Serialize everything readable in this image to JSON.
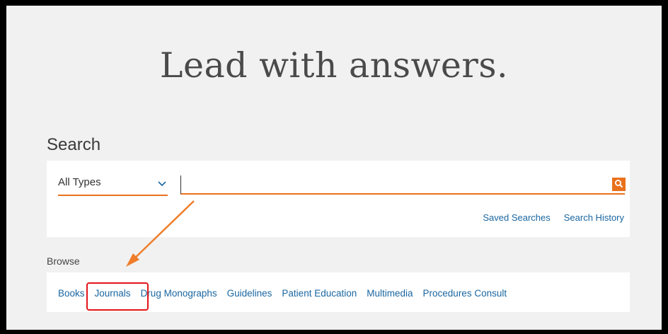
{
  "hero": {
    "title": "Lead with answers."
  },
  "search": {
    "label": "Search",
    "type_select": {
      "value": "All Types",
      "icon": "chevron-down-icon"
    },
    "input": {
      "value": "",
      "placeholder": ""
    },
    "button_icon": "search-icon",
    "links": [
      {
        "label": "Saved Searches"
      },
      {
        "label": "Search History"
      }
    ]
  },
  "browse": {
    "label": "Browse",
    "links": [
      {
        "label": "Books"
      },
      {
        "label": "Journals"
      },
      {
        "label": "Drug Monographs"
      },
      {
        "label": "Guidelines"
      },
      {
        "label": "Patient Education"
      },
      {
        "label": "Multimedia"
      },
      {
        "label": "Procedures Consult"
      }
    ]
  },
  "colors": {
    "accent": "#e9711c",
    "link": "#1a66a0",
    "annotation_arrow": "#ef7d2b",
    "annotation_box": "#e3141a",
    "background": "#f1f1f1"
  }
}
